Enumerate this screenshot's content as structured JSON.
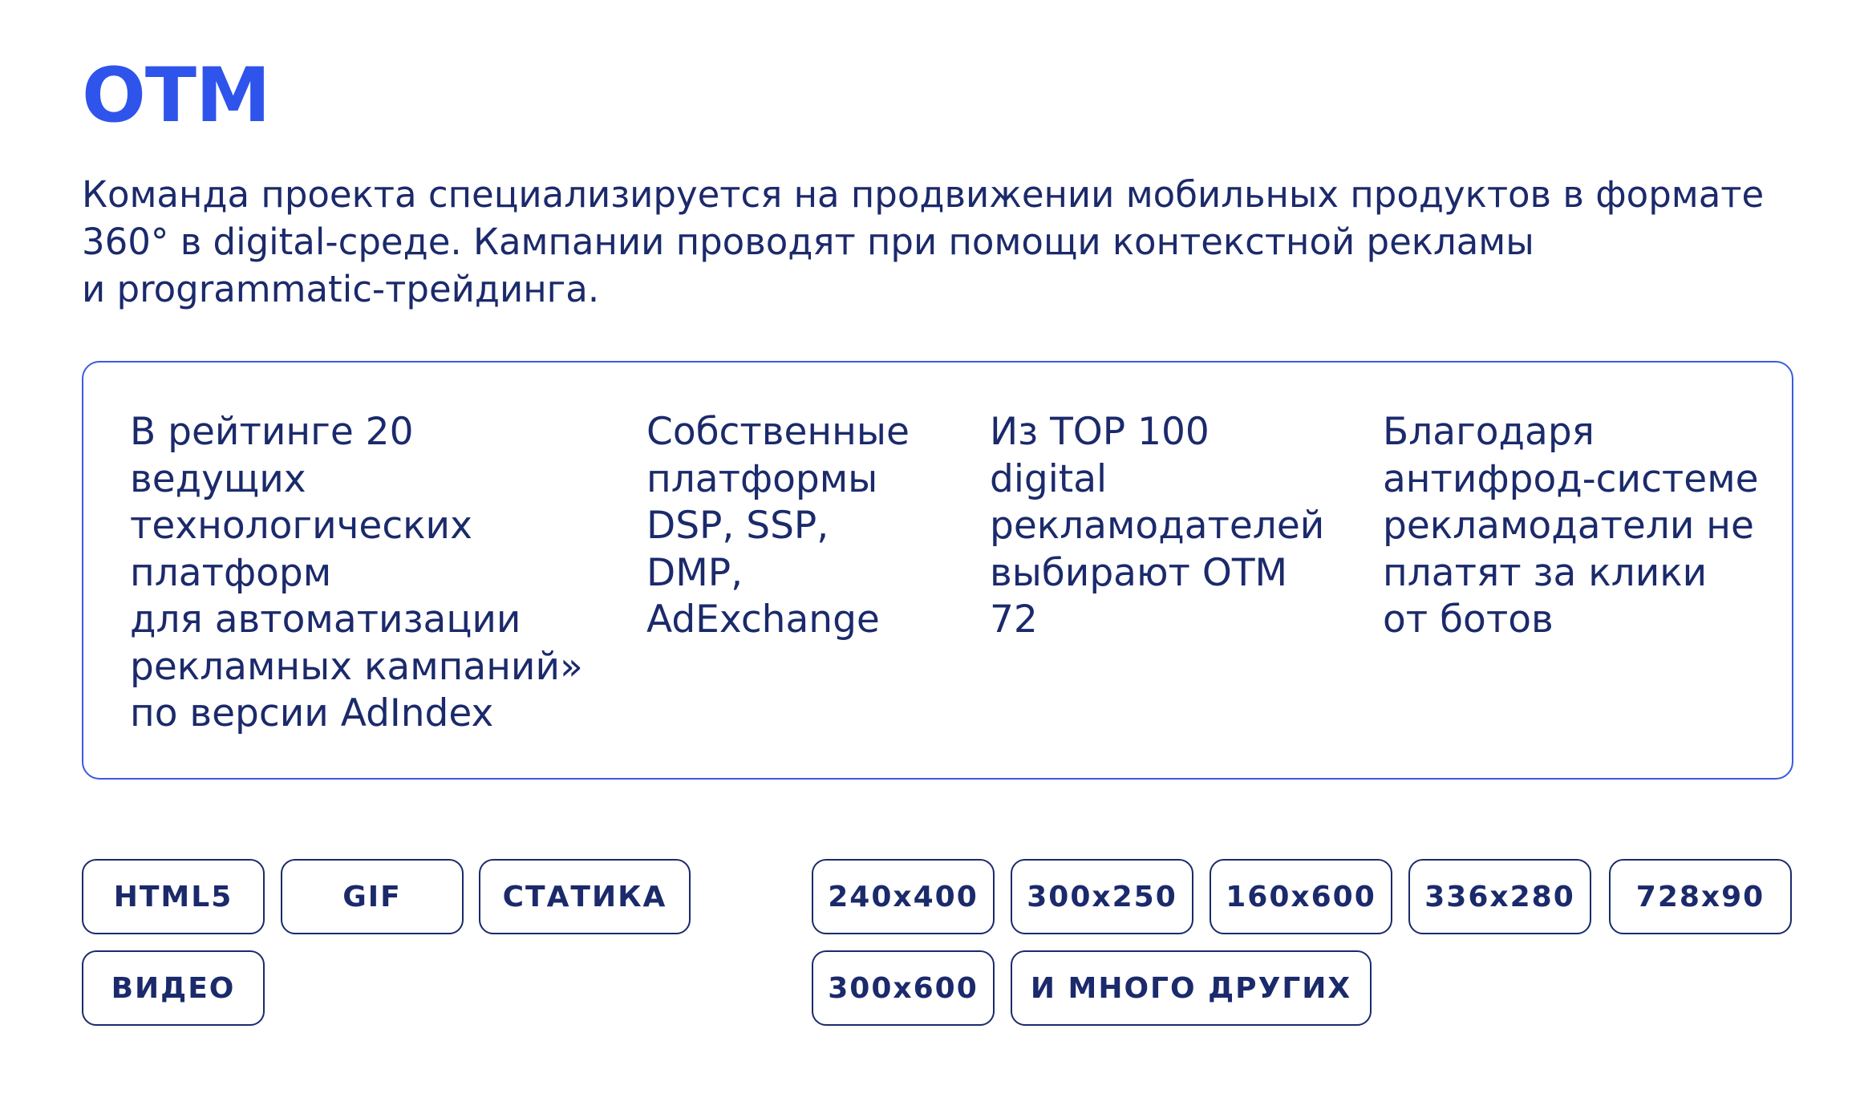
{
  "header": {
    "title": "OTM"
  },
  "intro": {
    "lines": [
      "Команда проекта специализируется на продвижении мобильных продуктов в формате",
      "360° в digital-среде. Кампании проводят при помощи контекстной рекламы",
      "и programmatic-трейдинга."
    ]
  },
  "features": [
    {
      "lines": [
        "В рейтинге 20",
        "ведущих",
        "технологических",
        "платформ",
        "для автоматизации",
        "рекламных кампаний»",
        "по версии AdIndex"
      ]
    },
    {
      "lines": [
        "Собственные",
        "платформы",
        "DSP, SSP,",
        "DMP,",
        "AdExchange"
      ]
    },
    {
      "lines": [
        "Из TOP 100",
        "digital",
        "рекламодателей",
        "выбирают OTM",
        "72"
      ]
    },
    {
      "lines": [
        "Благодаря",
        "антифрод-системе",
        "рекламодатели не",
        "платят за клики",
        "от ботов"
      ]
    }
  ],
  "formats": [
    "HTML5",
    "GIF",
    "СТАТИКА",
    "ВИДЕО"
  ],
  "sizes": [
    "240x400",
    "300x250",
    "160x600",
    "336x280",
    "728x90",
    "300x600",
    "И МНОГО ДРУГИХ"
  ]
}
